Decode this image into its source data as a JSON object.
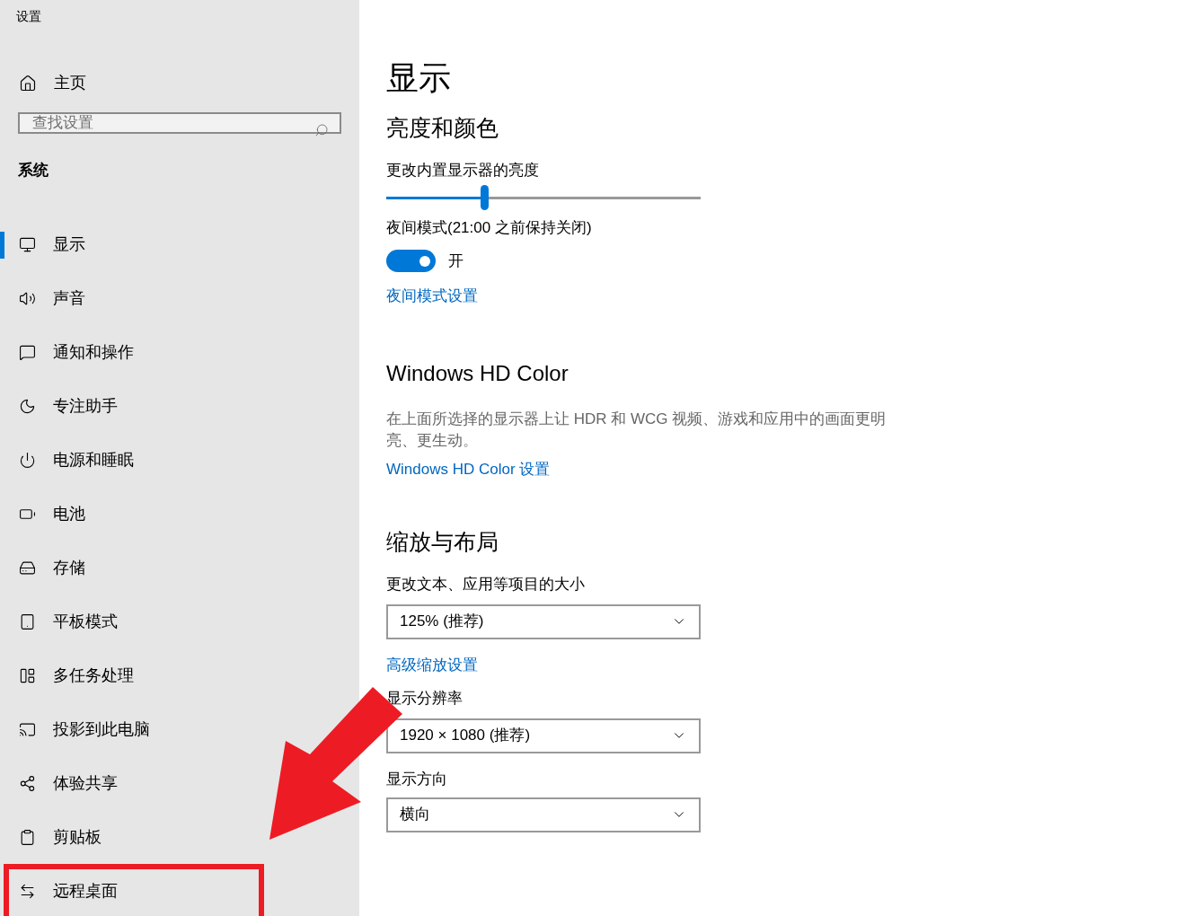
{
  "window": {
    "title": "设置"
  },
  "sidebar": {
    "home": "主页",
    "search": {
      "placeholder": "查找设置"
    },
    "section": "系统",
    "items": [
      {
        "label": "显示",
        "selected": true
      },
      {
        "label": "声音",
        "selected": false
      },
      {
        "label": "通知和操作",
        "selected": false
      },
      {
        "label": "专注助手",
        "selected": false
      },
      {
        "label": "电源和睡眠",
        "selected": false
      },
      {
        "label": "电池",
        "selected": false
      },
      {
        "label": "存储",
        "selected": false
      },
      {
        "label": "平板模式",
        "selected": false
      },
      {
        "label": "多任务处理",
        "selected": false
      },
      {
        "label": "投影到此电脑",
        "selected": false
      },
      {
        "label": "体验共享",
        "selected": false
      },
      {
        "label": "剪贴板",
        "selected": false
      },
      {
        "label": "远程桌面",
        "selected": false
      }
    ]
  },
  "page": {
    "title": "显示",
    "brightness": {
      "heading": "亮度和颜色",
      "label": "更改内置显示器的亮度",
      "level": 0.31,
      "night_label": "夜间模式(21:00 之前保持关闭)",
      "night_on": true,
      "night_state": "开",
      "night_link": "夜间模式设置"
    },
    "hd_color": {
      "heading": "Windows HD Color",
      "description": "在上面所选择的显示器上让 HDR 和 WCG 视频、游戏和应用中的画面更明亮、更生动。",
      "link": "Windows HD Color 设置"
    },
    "scale": {
      "heading": "缩放与布局",
      "size_label": "更改文本、应用等项目的大小",
      "size_value": "125% (推荐)",
      "advanced_link": "高级缩放设置",
      "resolution_label": "显示分辨率",
      "resolution_value": "1920 × 1080 (推荐)",
      "orientation_label": "显示方向",
      "orientation_value": "横向"
    }
  }
}
